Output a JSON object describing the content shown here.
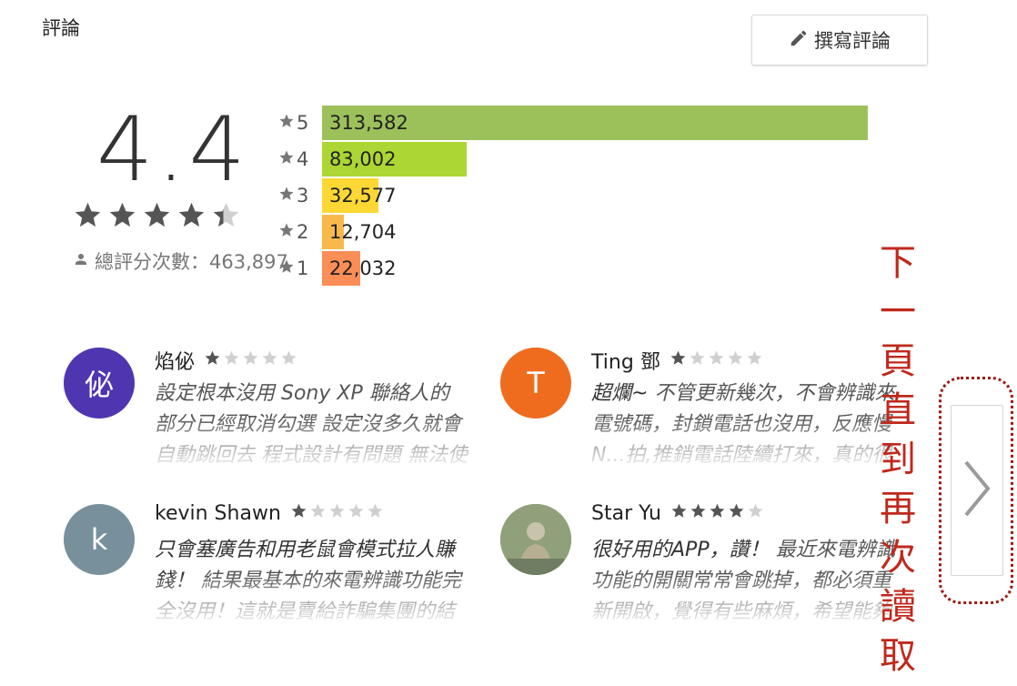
{
  "header": {
    "title": "評論",
    "write_label": "撰寫評論"
  },
  "summary": {
    "score": "4.4",
    "stars": 4.4,
    "total_label": "總評分次數：463,897"
  },
  "histogram": [
    {
      "star": "5",
      "count": "313,582",
      "fraction": 0.676,
      "color": "#9cc15b"
    },
    {
      "star": "4",
      "count": "83,002",
      "fraction": 0.179,
      "color": "#acd633"
    },
    {
      "star": "3",
      "count": "32,577",
      "fraction": 0.07,
      "color": "#fdd835"
    },
    {
      "star": "2",
      "count": "12,704",
      "fraction": 0.027,
      "color": "#f9b94a"
    },
    {
      "star": "1",
      "count": "22,032",
      "fraction": 0.047,
      "color": "#fb8d57"
    }
  ],
  "reviews": [
    {
      "name": "焰佖",
      "rating": 1,
      "avatar_letter": "佖",
      "avatar_color": "#5035b0",
      "title": "",
      "text": "設定根本沒用 Sony XP 聯絡人的部分已經取消勾選 設定沒多久就會自動跳回去 程式設計有問題 無法使用 一直跳"
    },
    {
      "name": "Ting 鄧",
      "rating": 1,
      "avatar_letter": "T",
      "avatar_color": "#ef6c1e",
      "title": "超爛~",
      "text": "不管更新幾次，不會辨識來電號碼，封鎖電話也沒用，反應慢N...拍,推銷電話陸續打來，真的很煩，也沒有用"
    },
    {
      "name": "kevin Shawn",
      "rating": 1,
      "avatar_letter": "k",
      "avatar_color": "#78909c",
      "title": "只會塞廣告和用老鼠會模式拉人賺錢！",
      "text": "結果最基本的來電辨識功能完全沒用！這就是賣給詐騙集團的結果吧"
    },
    {
      "name": "Star Yu",
      "rating": 4,
      "avatar_letter": "",
      "avatar_color": "#7d8a6a",
      "title": "很好用的APP，讚！",
      "text": "最近來電辨識功能的開關常常會跳掉，都必須重新開啟，覺得有些麻煩，希望能夠改善"
    }
  ],
  "annotation": "下一頁直到再次讀取",
  "icons": {
    "pencil": "pencil-icon",
    "person": "person-icon",
    "star": "star-icon",
    "next": "chevron-right-icon"
  },
  "colors": {
    "annotation": "#c0281c",
    "star_filled": "#555555",
    "star_empty": "#d0d0d0"
  }
}
